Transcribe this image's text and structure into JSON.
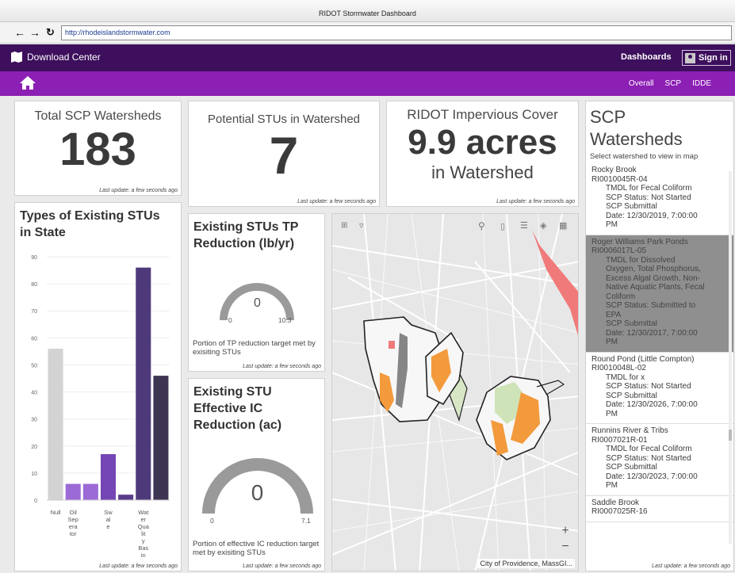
{
  "browser": {
    "title": "RIDOT Stormwater Dashboard",
    "url": "http://rhodeislandstormwater.com",
    "back": "←",
    "forward": "→",
    "reload": "↻"
  },
  "topbar": {
    "download_center": "Download Center",
    "dashboards": "Dashboards",
    "signin": "Sign in"
  },
  "subnav": {
    "tabs": [
      "Overall",
      "SCP",
      "IDDE"
    ]
  },
  "cards": {
    "watersheds": {
      "title": "Total SCP Watersheds",
      "value": "183",
      "footer": "Last update: a few seconds ago"
    },
    "stus": {
      "title": "Potential STUs in Watershed",
      "value": "7",
      "footer": "Last update: a few seconds ago"
    },
    "impervious": {
      "title": "RIDOT Impervious Cover",
      "value": "9.9 acres",
      "subtitle": "in Watershed",
      "footer": "Last update: a few seconds ago"
    }
  },
  "chart_data": {
    "type": "bar",
    "title": "Types of Existing STUs in State",
    "categories": [
      "Null",
      "Oil Seperator",
      "Swale",
      "Water Quality Basin"
    ],
    "category_tick_labels": [
      "Null",
      "Oil\nSep\nera\ntor",
      "Sw\nal\ne",
      "Wat\ner\nQua\nlit\ny\nBas\nin"
    ],
    "values": [
      56,
      6,
      6,
      17,
      2,
      86,
      46
    ],
    "bar_colors": [
      "#d3d3d3",
      "#9b6ad6",
      "#9b6ad6",
      "#7446b4",
      "#5a3a8a",
      "#4e3a7a",
      "#3e3552"
    ],
    "ylim": [
      0,
      90
    ],
    "yticks": [
      0,
      10,
      20,
      30,
      40,
      50,
      60,
      70,
      80,
      90
    ],
    "grid": true,
    "footer": "Last update: a few seconds ago"
  },
  "gauges": {
    "tp": {
      "title": "Existing STUs TP Reduction (lb/yr)",
      "value": "0",
      "min": "0",
      "max": "10.3",
      "caption": "Portion of TP reduction target met by exisiting STUs",
      "footer": "Last update: a few seconds ago"
    },
    "ic": {
      "title": "Existing STU Effective IC Reduction (ac)",
      "value": "0",
      "min": "0",
      "max": "7.1",
      "caption": "Portion of effective IC reduction target met by exisiting STUs",
      "footer": "Last update: a few seconds ago"
    }
  },
  "map": {
    "attribution": "City of Providence, MassGI...",
    "zoom_in": "+",
    "zoom_out": "−"
  },
  "watersheds": {
    "title": "SCP Watersheds",
    "subtitle": "Select watershed to view in map",
    "footer": "Last update: a few seconds ago",
    "items": [
      {
        "name": "Rocky Brook",
        "id": "RI0010045R-04",
        "lines": [
          "TMDL for Fecal Coliform",
          "SCP Status: Not Started",
          "SCP Submittal",
          "Date: 12/30/2019, 7:00:00",
          "PM"
        ]
      },
      {
        "name": "Roger Williams Park Ponds",
        "id": "RI0006017L-05",
        "lines": [
          "TMDL for Dissolved",
          "Oxygen, Total Phosphorus,",
          "Excess Algal Growth, Non-",
          "Native Aquatic Plants, Fecal",
          "Coliform",
          "SCP Status: Submitted to",
          "EPA",
          "SCP Submittal",
          "Date: 12/30/2017, 7:00:00",
          "PM"
        ]
      },
      {
        "name": "Round Pond (Little Compton)",
        "id": "RI0010048L-02",
        "lines": [
          "TMDL for x",
          "SCP Status: Not Started",
          "SCP Submittal",
          "Date: 12/30/2026, 7:00:00",
          "PM"
        ]
      },
      {
        "name": "Runnins River & Tribs",
        "id": "RI0007021R-01",
        "lines": [
          "TMDL for Fecal Coliform",
          "SCP Status: Not Started",
          "SCP Submittal",
          "Date: 12/30/2023, 7:00:00",
          "PM"
        ]
      },
      {
        "name": "Saddle Brook",
        "id": "RI0007025R-16",
        "lines": []
      }
    ]
  }
}
